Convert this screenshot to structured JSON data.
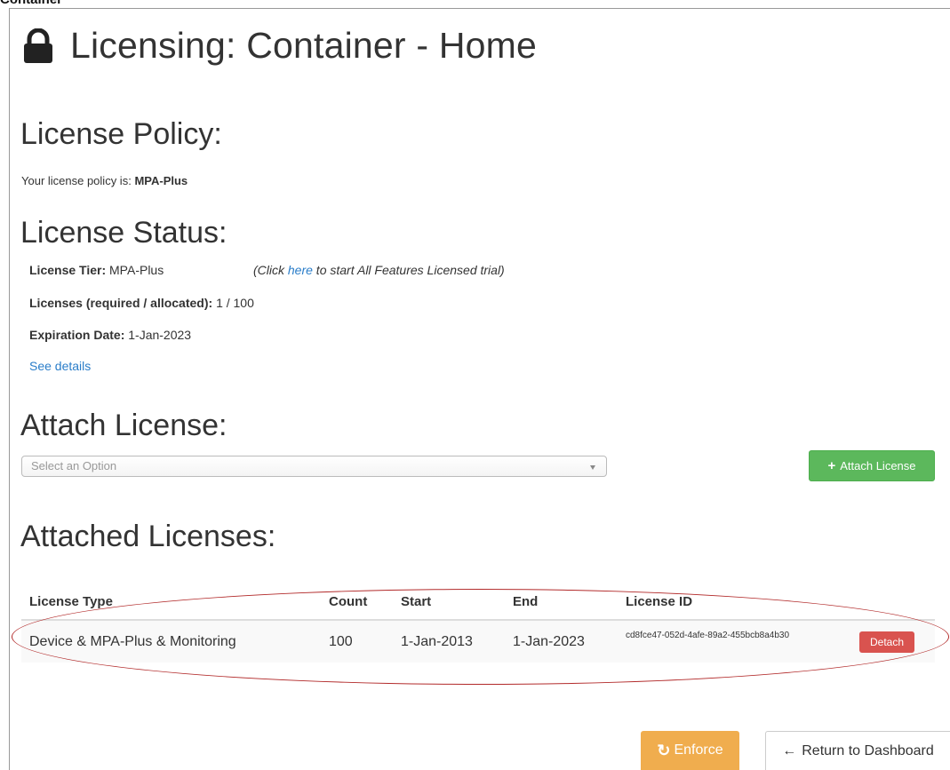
{
  "top_crop_text": "Container",
  "page": {
    "title": "Licensing: Container - Home",
    "icon": "lock-icon"
  },
  "policy": {
    "heading": "License Policy:",
    "label": "Your license policy is:",
    "value": "MPA-Plus"
  },
  "status": {
    "heading": "License Status:",
    "tier_label": "License Tier:",
    "tier_value": "MPA-Plus",
    "trial_prefix": "(Click ",
    "trial_link": "here",
    "trial_suffix": " to start All Features Licensed trial)",
    "licenses_label": "Licenses (required / allocated):",
    "licenses_value": "1 / 100",
    "expiration_label": "Expiration Date:",
    "expiration_value": "1-Jan-2023",
    "details_link": "See details"
  },
  "attach": {
    "heading": "Attach License:",
    "select_placeholder": "Select an Option",
    "button_label": "Attach License"
  },
  "attached": {
    "heading": "Attached Licenses:",
    "columns": [
      "License Type",
      "Count",
      "Start",
      "End",
      "License ID"
    ],
    "rows": [
      {
        "type": "Device & MPA-Plus & Monitoring",
        "count": "100",
        "start": "1-Jan-2013",
        "end": "1-Jan-2023",
        "id": "cd8fce47-052d-4afe-89a2-455bcb8a4b30",
        "action": "Detach"
      }
    ]
  },
  "footer": {
    "enforce_label": "Enforce",
    "return_label": "Return to Dashboard"
  },
  "colors": {
    "link": "#2a7dc9",
    "success": "#5cb85c",
    "danger": "#d9534f",
    "warning": "#f0ad4e",
    "annotation": "#b22a2a"
  }
}
